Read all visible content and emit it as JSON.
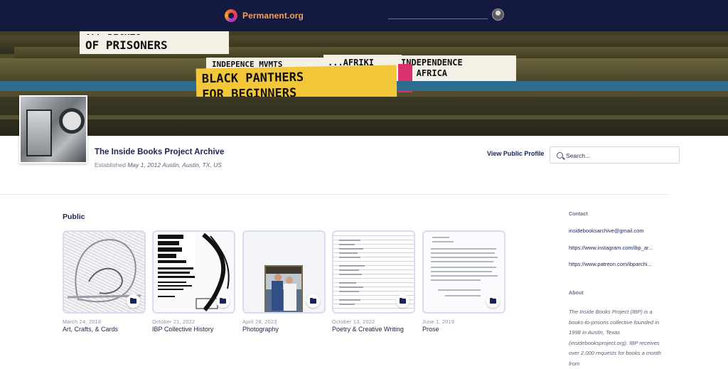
{
  "topbar": {
    "logo_text": "Permanent.org"
  },
  "banner": {
    "labels": [
      "ALL RIGHTS",
      "OF PRISONERS",
      "INDEPENCE MVMTS",
      "...AFRIKI",
      "INDEPENDENCE",
      "IN AFRICA",
      "BLACK PANTHERS",
      "FOR BEGINNERS"
    ]
  },
  "profile": {
    "archive_name": "The Inside Books Project Archive",
    "established_label": "Established",
    "established_value": "May 1, 2012 Austin, Austin, TX, US",
    "view_profile_label": "View Public Profile",
    "search_placeholder": "Search..."
  },
  "main": {
    "section_heading": "Public",
    "items": [
      {
        "date": "March 24, 2018",
        "title": "Art, Crafts, & Cards",
        "icon": "folder-icon"
      },
      {
        "date": "October 21, 2022",
        "title": "IBP Collective History",
        "icon": "folder-icon"
      },
      {
        "date": "April 28, 2023",
        "title": "Photography",
        "icon": "folder-icon"
      },
      {
        "date": "October 13, 2022",
        "title": "Poetry & Creative Writing",
        "icon": "folder-icon"
      },
      {
        "date": "June 1, 2019",
        "title": "Prose",
        "icon": "folder-icon"
      }
    ]
  },
  "sidebar": {
    "contact_heading": "Contact",
    "links": [
      "insidebooksarchive@gmail.com",
      "https://www.instagram.com/ibp_ar...",
      "https://www.patreon.com/ibparchi..."
    ],
    "about_heading": "About",
    "about_text": "The Inside Books Project (IBP) is a books-to-prisons collective founded in 1998 in Austin, Texas (insidebooksproject.org). IBP receives over 2,000 requests for books a month from"
  },
  "colors": {
    "topbar": "#141a3f",
    "brand_text": "#f2a25c",
    "navy_text": "#1b2352",
    "card_border": "#d8dcef"
  }
}
